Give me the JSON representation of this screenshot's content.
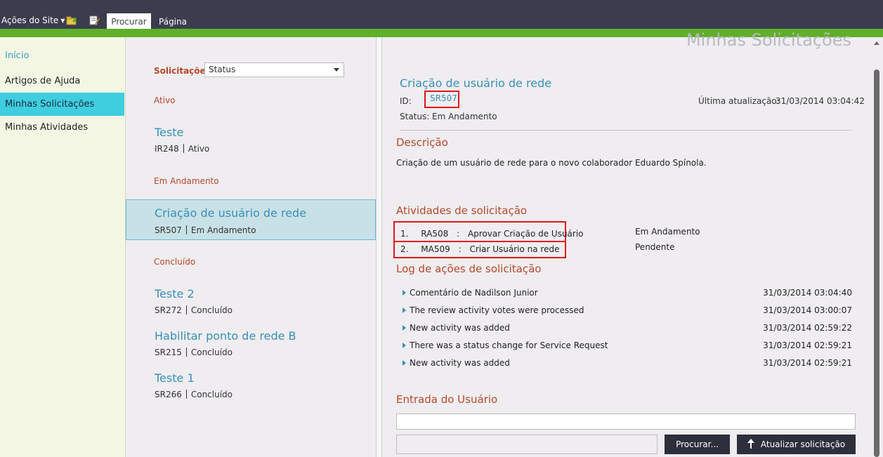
{
  "ribbon": {
    "site_actions": "Ações do Site",
    "tabs": [
      "Procurar",
      "Página"
    ]
  },
  "leftnav": {
    "items": [
      "Início",
      "Artigos de Ajuda",
      "Minhas Solicitações",
      "Minhas Atividades"
    ],
    "selected": "Minhas Solicitações"
  },
  "list": {
    "filter_label": "Solicitações",
    "filter_value": "Status",
    "groups": [
      {
        "title": "Ativo",
        "items": [
          {
            "title": "Teste",
            "id": "IR248",
            "status": "Ativo"
          }
        ]
      },
      {
        "title": "Em Andamento",
        "items": [
          {
            "title": "Criação de usuário de rede",
            "id": "SR507",
            "status": "Em Andamento",
            "selected": true
          }
        ]
      },
      {
        "title": "Concluído",
        "items": [
          {
            "title": "Teste 2",
            "id": "SR272",
            "status": "Concluído"
          },
          {
            "title": "Habilitar ponto de rede B",
            "id": "SR215",
            "status": "Concluído"
          },
          {
            "title": "Teste 1",
            "id": "SR266",
            "status": "Concluído"
          }
        ]
      }
    ]
  },
  "detail": {
    "page_header": "Minhas Solicitações",
    "title": "Criação de usuário de rede",
    "id_label": "ID:",
    "id_value": "SR507",
    "last_update_label": "Última atualização:",
    "last_update_value": "31/03/2014 03:04:42",
    "status_label": "Status:",
    "status_value": "Em Andamento",
    "description_heading": "Descrição",
    "description_text": "Criação de um usuário de rede para o novo colaborador Eduardo Spínola.",
    "activities_heading": "Atividades de solicitação",
    "activities": [
      {
        "num": "1.",
        "id": "RA508",
        "sep": ":",
        "name": "Aprovar Criação de Usuário",
        "status": "Em Andamento"
      },
      {
        "num": "2.",
        "id": "MA509",
        "sep": ":",
        "name": "Criar Usuário na rede",
        "status": "Pendente"
      }
    ],
    "log_heading": "Log de ações de solicitação",
    "log": [
      {
        "text": "Comentário de Nadilson Junior",
        "time": "31/03/2014 03:04:40"
      },
      {
        "text": "The review activity votes were processed",
        "time": "31/03/2014 03:00:07"
      },
      {
        "text": "New activity was added",
        "time": "31/03/2014 02:59:22"
      },
      {
        "text": "There was a status change for Service Request",
        "time": "31/03/2014 02:59:21"
      },
      {
        "text": "New activity was added",
        "time": "31/03/2014 02:59:21"
      }
    ],
    "user_input_heading": "Entrada do Usuário",
    "browse_button": "Procurar...",
    "update_button": "Atualizar solicitação"
  },
  "colors": {
    "ribbon": "#3b3d4e",
    "ribbon_accent": "#5faf2b",
    "nav_selected": "#3fcde0",
    "link": "#3a8fb7",
    "heading": "#b5482b",
    "highlight_box": "#e0151b"
  }
}
